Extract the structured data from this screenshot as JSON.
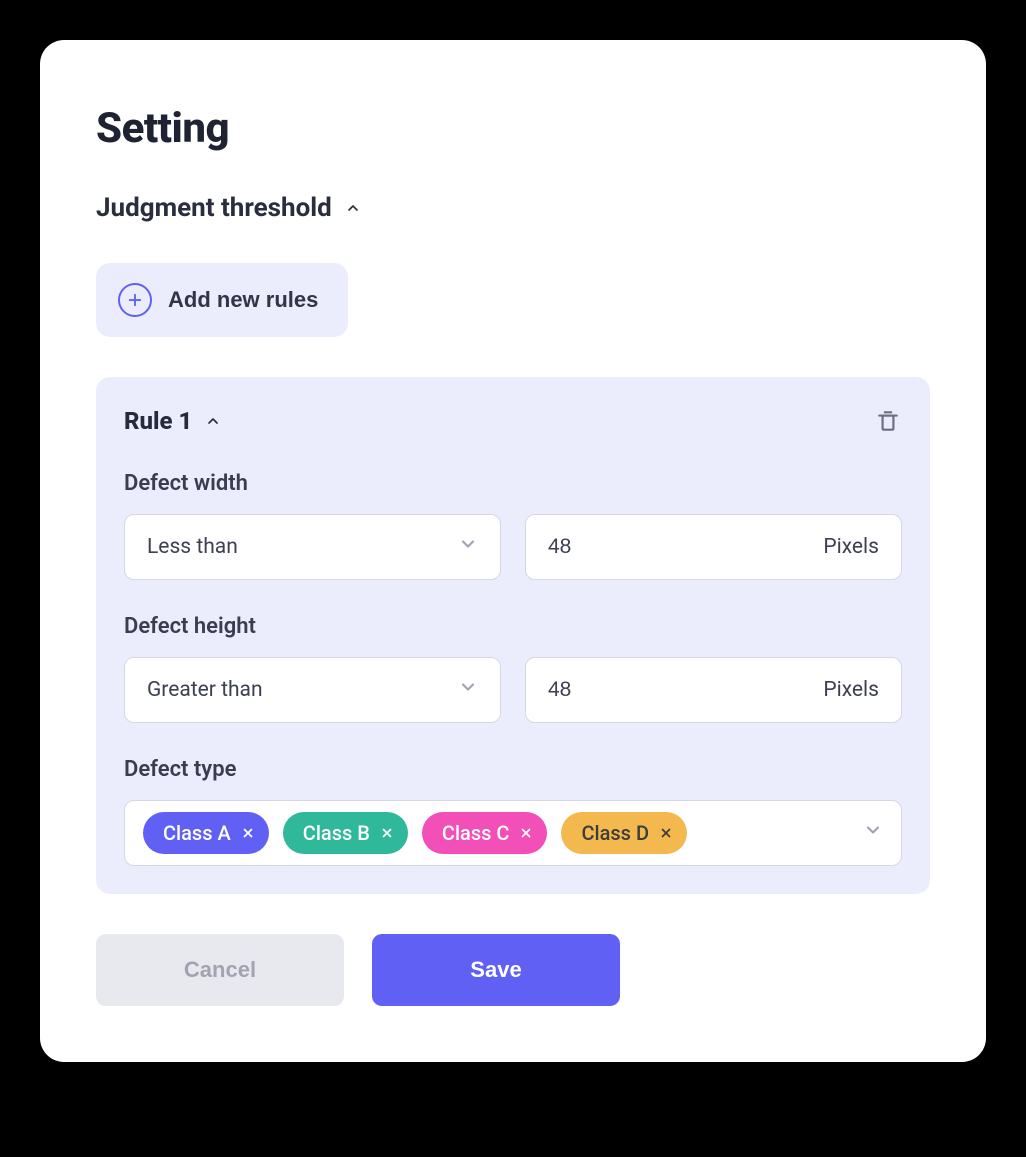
{
  "title": "Setting",
  "section": {
    "label": "Judgment threshold"
  },
  "add_button": {
    "label": "Add new rules"
  },
  "rule": {
    "title": "Rule 1",
    "width": {
      "label": "Defect width",
      "operator": "Less than",
      "value": "48",
      "unit": "Pixels"
    },
    "height": {
      "label": "Defect height",
      "operator": "Greater than",
      "value": "48",
      "unit": "Pixels"
    },
    "type": {
      "label": "Defect type",
      "tags": {
        "a": "Class A",
        "b": "Class B",
        "c": "Class C",
        "d": "Class D"
      }
    }
  },
  "footer": {
    "cancel": "Cancel",
    "save": "Save"
  }
}
